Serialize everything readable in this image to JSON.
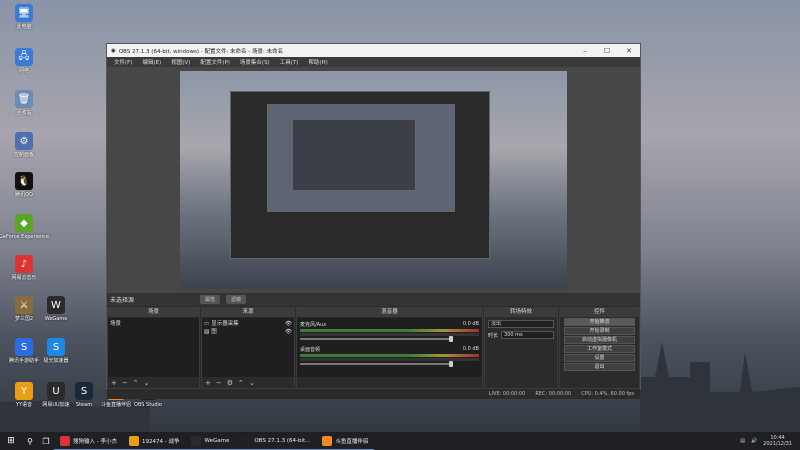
{
  "desktop": {
    "icons": [
      {
        "label": "此电脑",
        "glyph": "🖥",
        "color": "#3a7bd5"
      },
      {
        "label": "网络",
        "glyph": "🖧",
        "color": "#3a7bd5"
      },
      {
        "label": "回收站",
        "glyph": "🗑",
        "color": "#6b8db5"
      },
      {
        "label": "控制面板",
        "glyph": "⚙",
        "color": "#4f6fae"
      },
      {
        "label": "腾讯QQ",
        "glyph": "🐧",
        "color": "#111"
      },
      {
        "label": "GeForce Experience",
        "glyph": "◆",
        "color": "#5aa524"
      },
      {
        "label": "网易云音乐",
        "glyph": "♪",
        "color": "#d33"
      },
      {
        "label": "梦三国2",
        "glyph": "⚔",
        "color": "#8a6c3c"
      },
      {
        "label": "WeGame",
        "glyph": "W",
        "color": "#2b2b2b"
      },
      {
        "label": "腾讯手游助手",
        "glyph": "S",
        "color": "#2d6be4"
      },
      {
        "label": "极光加速器",
        "glyph": "S",
        "color": "#1e88e5"
      },
      {
        "label": "YY语音",
        "glyph": "Y",
        "color": "#e8a012"
      },
      {
        "label": "网易UU加速",
        "glyph": "U",
        "color": "#2b2b2b"
      },
      {
        "label": "Steam",
        "glyph": "S",
        "color": "#1b2838"
      },
      {
        "label": "斗鱼直播伴侣",
        "glyph": "D",
        "color": "#f58a1f"
      },
      {
        "label": "OBS Studio",
        "glyph": "◉",
        "color": "#222"
      }
    ]
  },
  "obs": {
    "title": "OBS 27.1.3 (64-bit, windows) - 配置文件: 未命名 - 场景: 未命名",
    "menu": [
      "文件(F)",
      "编辑(E)",
      "视图(V)",
      "配置文件(P)",
      "场景集合(S)",
      "工具(T)",
      "帮助(H)"
    ],
    "scene_label": "未选择源",
    "scene_tags": [
      "属性",
      "滤镜"
    ],
    "docks": {
      "scenes": {
        "title": "场景",
        "items": [
          "场景"
        ]
      },
      "sources": {
        "title": "来源",
        "items": [
          "显示器采集",
          "图"
        ]
      },
      "mixer": {
        "title": "混音器",
        "channels": [
          {
            "name": "麦克风/Aux",
            "db": "0.0 dB"
          },
          {
            "name": "桌面音频",
            "db": "0.0 dB"
          }
        ]
      },
      "transitions": {
        "title": "转场特效",
        "type": "淡出",
        "duration_label": "时长",
        "duration": "300 ms"
      },
      "controls": {
        "title": "控件",
        "buttons": [
          "开始推流",
          "开始录制",
          "启动虚拟摄像机",
          "工作室模式",
          "设置",
          "退出"
        ]
      }
    },
    "status": {
      "live": "LIVE: 00:00:00",
      "rec": "REC: 00:00:00",
      "cpu": "CPU: 0.4%, 60.00 fps"
    }
  },
  "taskbar": {
    "tasks": [
      {
        "label": "搜狗输入 - 李小杰",
        "color": "#d33"
      },
      {
        "label": "192474 - 战争",
        "color": "#e8a012"
      },
      {
        "label": "WeGame",
        "color": "#2b2b2b"
      },
      {
        "label": "OBS 27.1.3 (64-bit...",
        "color": "#222"
      },
      {
        "label": "斗鱼直播伴侣",
        "color": "#f58a1f"
      }
    ],
    "time": "10:44",
    "date": "2021/12/31"
  }
}
